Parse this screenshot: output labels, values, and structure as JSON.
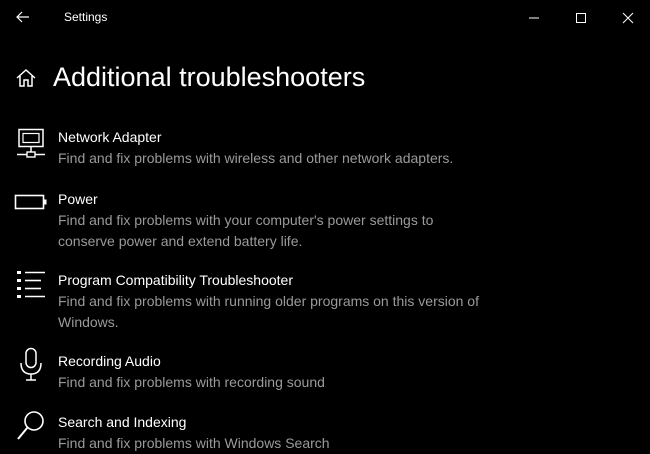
{
  "window": {
    "title": "Settings"
  },
  "page": {
    "title": "Additional troubleshooters"
  },
  "troubleshooters": [
    {
      "title": "Network Adapter",
      "description": "Find and fix problems with wireless and other network adapters.",
      "icon": "network-adapter-icon"
    },
    {
      "title": "Power",
      "description": "Find and fix problems with your computer's power settings to conserve power and extend battery life.",
      "icon": "battery-icon"
    },
    {
      "title": "Program Compatibility Troubleshooter",
      "description": "Find and fix problems with running older programs on this version of Windows.",
      "icon": "list-icon"
    },
    {
      "title": "Recording Audio",
      "description": "Find and fix problems with recording sound",
      "icon": "microphone-icon"
    },
    {
      "title": "Search and Indexing",
      "description": "Find and fix problems with Windows Search",
      "icon": "search-icon"
    }
  ],
  "colors": {
    "background": "#000000",
    "primary_text": "#ffffff",
    "secondary_text": "#9a9a9a"
  }
}
